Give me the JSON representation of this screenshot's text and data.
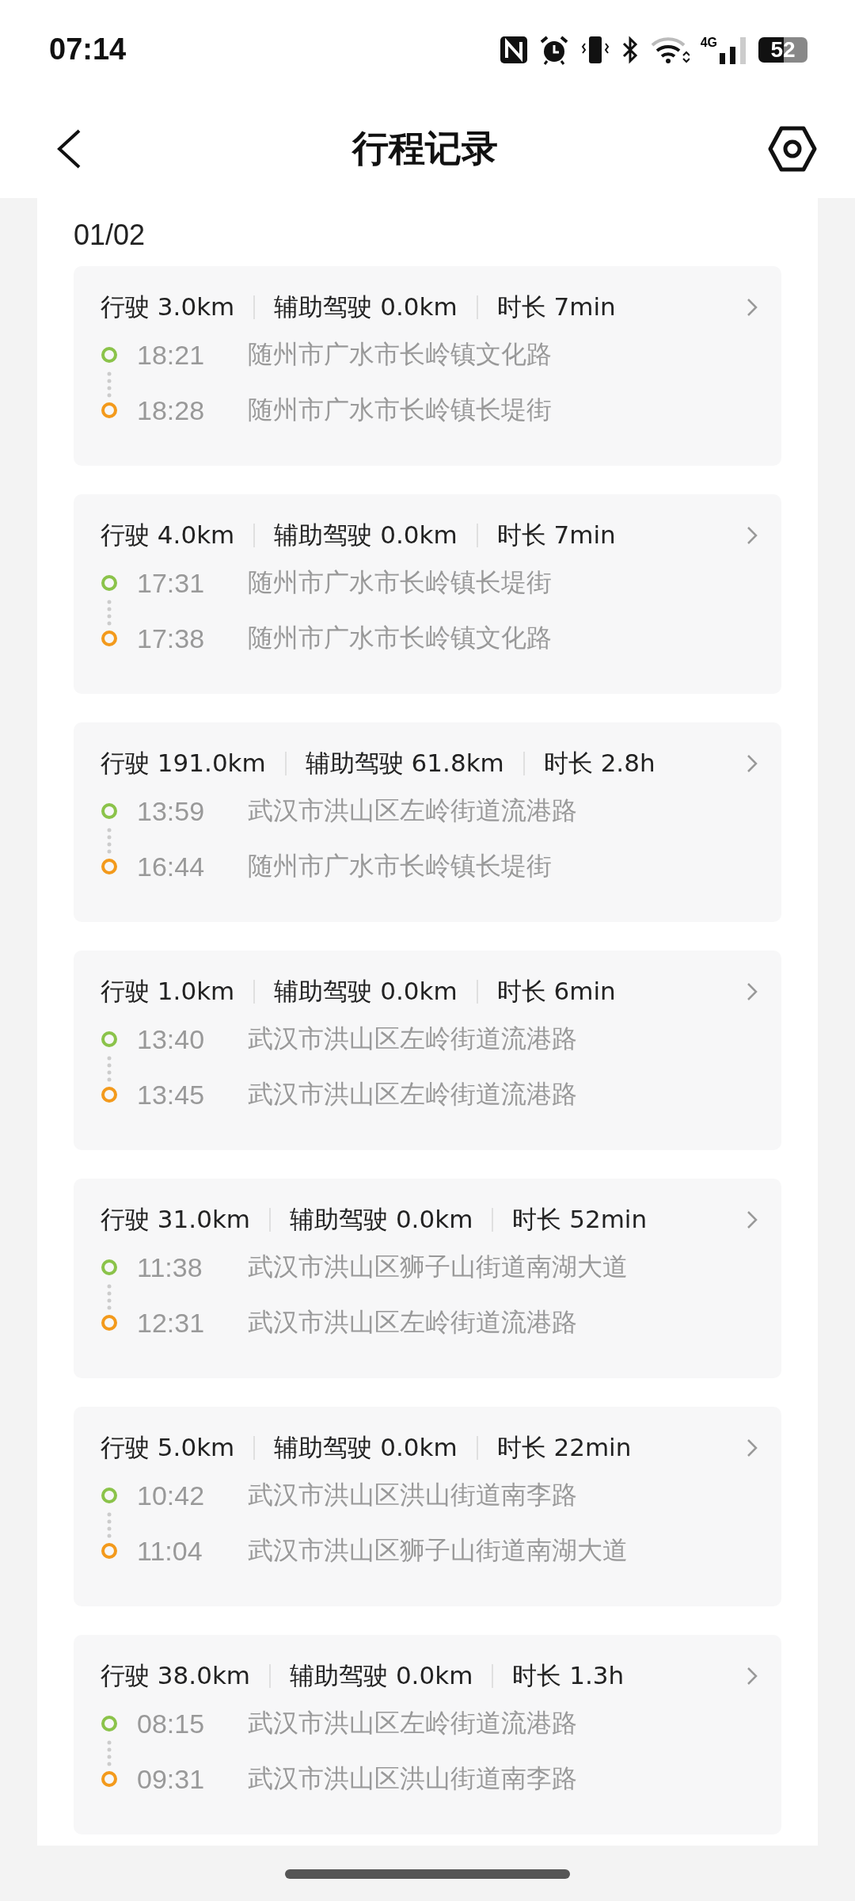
{
  "status_bar": {
    "time": "07:14",
    "network": "4G",
    "battery": "52"
  },
  "header": {
    "title": "行程记录"
  },
  "date": "01/02",
  "trips": [
    {
      "distance": "行驶 3.0km",
      "assisted": "辅助驾驶 0.0km",
      "duration": "时长 7min",
      "start": {
        "time": "18:21",
        "place": "随州市广水市长岭镇文化路"
      },
      "end": {
        "time": "18:28",
        "place": "随州市广水市长岭镇长堤街"
      }
    },
    {
      "distance": "行驶 4.0km",
      "assisted": "辅助驾驶 0.0km",
      "duration": "时长 7min",
      "start": {
        "time": "17:31",
        "place": "随州市广水市长岭镇长堤街"
      },
      "end": {
        "time": "17:38",
        "place": "随州市广水市长岭镇文化路"
      }
    },
    {
      "distance": "行驶 191.0km",
      "assisted": "辅助驾驶 61.8km",
      "duration": "时长 2.8h",
      "start": {
        "time": "13:59",
        "place": "武汉市洪山区左岭街道流港路"
      },
      "end": {
        "time": "16:44",
        "place": "随州市广水市长岭镇长堤街"
      }
    },
    {
      "distance": "行驶 1.0km",
      "assisted": "辅助驾驶 0.0km",
      "duration": "时长 6min",
      "start": {
        "time": "13:40",
        "place": "武汉市洪山区左岭街道流港路"
      },
      "end": {
        "time": "13:45",
        "place": "武汉市洪山区左岭街道流港路"
      }
    },
    {
      "distance": "行驶 31.0km",
      "assisted": "辅助驾驶 0.0km",
      "duration": "时长 52min",
      "start": {
        "time": "11:38",
        "place": "武汉市洪山区狮子山街道南湖大道"
      },
      "end": {
        "time": "12:31",
        "place": "武汉市洪山区左岭街道流港路"
      }
    },
    {
      "distance": "行驶 5.0km",
      "assisted": "辅助驾驶 0.0km",
      "duration": "时长 22min",
      "start": {
        "time": "10:42",
        "place": "武汉市洪山区洪山街道南李路"
      },
      "end": {
        "time": "11:04",
        "place": "武汉市洪山区狮子山街道南湖大道"
      }
    },
    {
      "distance": "行驶 38.0km",
      "assisted": "辅助驾驶 0.0km",
      "duration": "时长 1.3h",
      "start": {
        "time": "08:15",
        "place": "武汉市洪山区左岭街道流港路"
      },
      "end": {
        "time": "09:31",
        "place": "武汉市洪山区洪山街道南李路"
      }
    }
  ]
}
